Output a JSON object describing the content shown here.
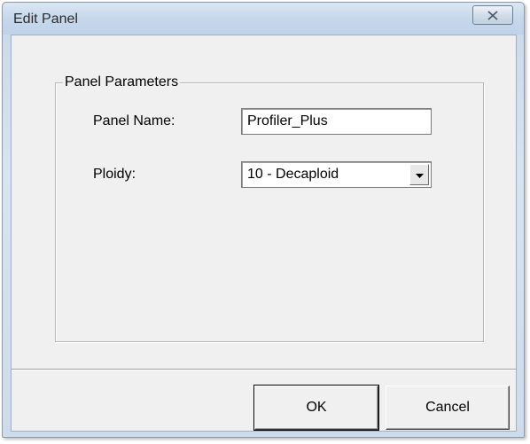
{
  "window": {
    "title": "Edit Panel"
  },
  "icons": {
    "close": "close-icon",
    "dropdown": "chevron-down-icon"
  },
  "group": {
    "legend": "Panel Parameters",
    "panel_name_label": "Panel Name:",
    "panel_name_value": "Profiler_Plus",
    "ploidy_label": "Ploidy:",
    "ploidy_selected": "10 - Decaploid"
  },
  "buttons": {
    "ok_label": "OK",
    "cancel_label": "Cancel"
  },
  "colors": {
    "titlebar": "#c6d8ec",
    "client_background": "#f0f0f0"
  }
}
